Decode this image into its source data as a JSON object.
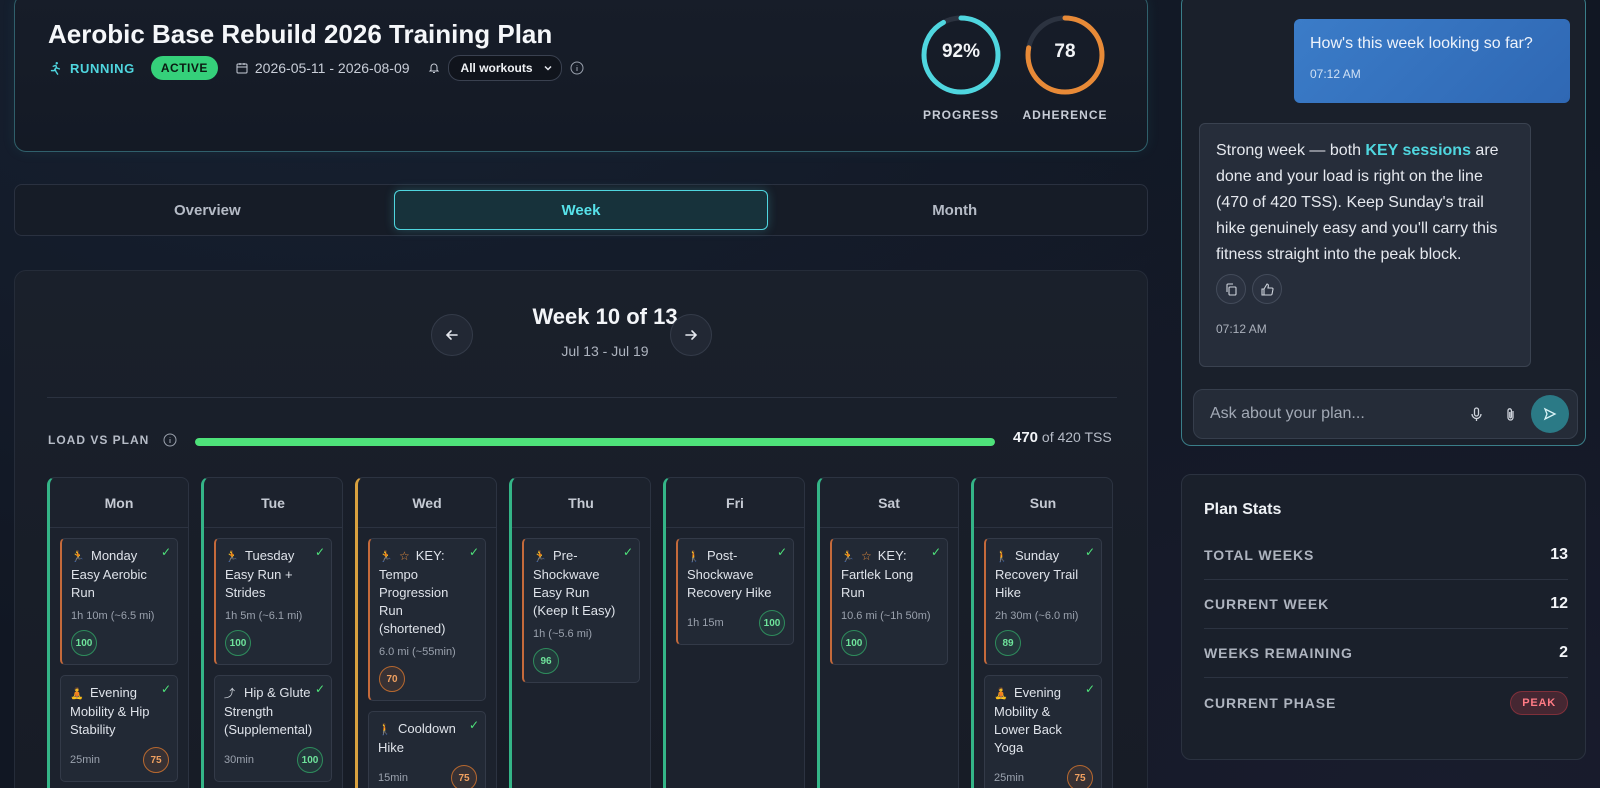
{
  "header": {
    "title": "Aerobic Base Rebuild 2026 Training Plan",
    "sport": "RUNNING",
    "status": "ACTIVE",
    "date_range": "2026-05-11 - 2026-08-09",
    "filter_selected": "All workouts",
    "progress": {
      "value": "92%",
      "label": "PROGRESS",
      "fraction": 0.92,
      "color": "#4fd6df"
    },
    "adherence": {
      "value": "78",
      "label": "ADHERENCE",
      "fraction": 0.78,
      "color": "#e88a37"
    }
  },
  "tabs": [
    {
      "label": "Overview",
      "active": false
    },
    {
      "label": "Week",
      "active": true
    },
    {
      "label": "Month",
      "active": false
    }
  ],
  "week": {
    "title": "Week 10 of 13",
    "range": "Jul 13 - Jul 19",
    "load_label": "LOAD VS PLAN",
    "load_actual": "470",
    "load_planned_text": "of 420 TSS",
    "load_fill_fraction": 1.0,
    "days": [
      {
        "name": "Mon",
        "workouts": [
          {
            "icon": "running-icon",
            "key": false,
            "title": "Monday Easy Aerobic Run",
            "meta": "1h 10m (~6.5 mi)",
            "score": "100",
            "score_tone": "good"
          },
          {
            "icon": "mobility-icon",
            "key": false,
            "title": "Evening Mobility & Hip Stability",
            "meta": "25min",
            "score": "75",
            "score_tone": "warn"
          }
        ]
      },
      {
        "name": "Tue",
        "workouts": [
          {
            "icon": "running-icon",
            "key": false,
            "title": "Tuesday Easy Run + Strides",
            "meta": "1h 5m (~6.1 mi)",
            "score": "100",
            "score_tone": "good"
          },
          {
            "icon": "strength-icon",
            "key": false,
            "title": "Hip & Glute Strength (Supplemental)",
            "meta": "30min",
            "score": "100",
            "score_tone": "good"
          }
        ]
      },
      {
        "name": "Wed",
        "workouts": [
          {
            "icon": "running-icon",
            "key": true,
            "title": "KEY: Tempo Progression Run (shortened)",
            "meta": "6.0 mi (~55min)",
            "score": "70",
            "score_tone": "warn"
          },
          {
            "icon": "hiking-icon",
            "key": false,
            "title": "Cooldown Hike",
            "meta": "15min",
            "score": "75",
            "score_tone": "warn"
          }
        ]
      },
      {
        "name": "Thu",
        "workouts": [
          {
            "icon": "running-icon",
            "key": false,
            "title": "Pre-Shockwave Easy Run (Keep It Easy)",
            "meta": "1h (~5.6 mi)",
            "score": "96",
            "score_tone": "good"
          }
        ]
      },
      {
        "name": "Fri",
        "workouts": [
          {
            "icon": "hiking-icon",
            "key": false,
            "title": "Post-Shockwave Recovery Hike",
            "meta": "1h 15m",
            "score": "100",
            "score_tone": "good"
          }
        ]
      },
      {
        "name": "Sat",
        "workouts": [
          {
            "icon": "running-icon",
            "key": true,
            "title": "KEY: Fartlek Long Run",
            "meta": "10.6 mi (~1h 50m)",
            "score": "100",
            "score_tone": "good"
          }
        ]
      },
      {
        "name": "Sun",
        "workouts": [
          {
            "icon": "hiking-icon",
            "key": false,
            "title": "Sunday Recovery Trail Hike",
            "meta": "2h 30m (~6.0 mi)",
            "score": "89",
            "score_tone": "good"
          },
          {
            "icon": "mobility-icon",
            "key": false,
            "title": "Evening Mobility & Lower Back Yoga",
            "meta": "25min",
            "score": "75",
            "score_tone": "warn"
          }
        ]
      }
    ]
  },
  "chat": {
    "user_message": "How's this week looking so far?",
    "user_time": "07:12 AM",
    "ai_message_before": "Strong week — both ",
    "ai_message_highlight": "KEY sessions",
    "ai_message_after": " are done and your load is right on the line (470 of 420 TSS). Keep Sunday's trail hike genuinely easy and you'll carry this fitness straight into the peak block.",
    "ai_time": "07:12 AM",
    "input_placeholder": "Ask about your plan..."
  },
  "stats": {
    "title": "Plan Stats",
    "rows": [
      {
        "label": "TOTAL WEEKS",
        "value": "13"
      },
      {
        "label": "CURRENT WEEK",
        "value": "12"
      },
      {
        "label": "WEEKS REMAINING",
        "value": "2"
      },
      {
        "label": "CURRENT PHASE",
        "value": "PEAK"
      }
    ]
  }
}
